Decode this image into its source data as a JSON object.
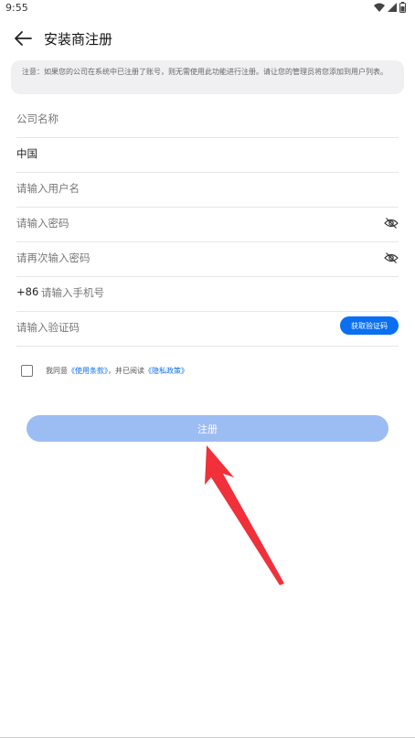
{
  "status_bar": {
    "time": "9:55"
  },
  "app_bar": {
    "title": "安装商注册"
  },
  "notice": {
    "text": "注意：如果您的公司在系统中已注册了账号，则无需使用此功能进行注册。请让您的管理员将您添加到用户列表。"
  },
  "form": {
    "company_name_placeholder": "公司名称",
    "country_value": "中国",
    "username_placeholder": "请输入用户名",
    "password_placeholder": "请输入密码",
    "confirm_password_placeholder": "请再次输入密码",
    "phone_prefix": "+86",
    "phone_placeholder": "请输入手机号",
    "code_placeholder": "请输入验证码",
    "get_code_label": "获取验证码"
  },
  "agreement": {
    "prefix": "我同意",
    "terms_link": "《使用条款》",
    "middle": "，并已阅读",
    "privacy_link": "《隐私政策》"
  },
  "register_label": "注册",
  "colors": {
    "accent": "#0a6ff1",
    "disabled_button": "#9cbcf4",
    "arrow": "#f0303a"
  }
}
